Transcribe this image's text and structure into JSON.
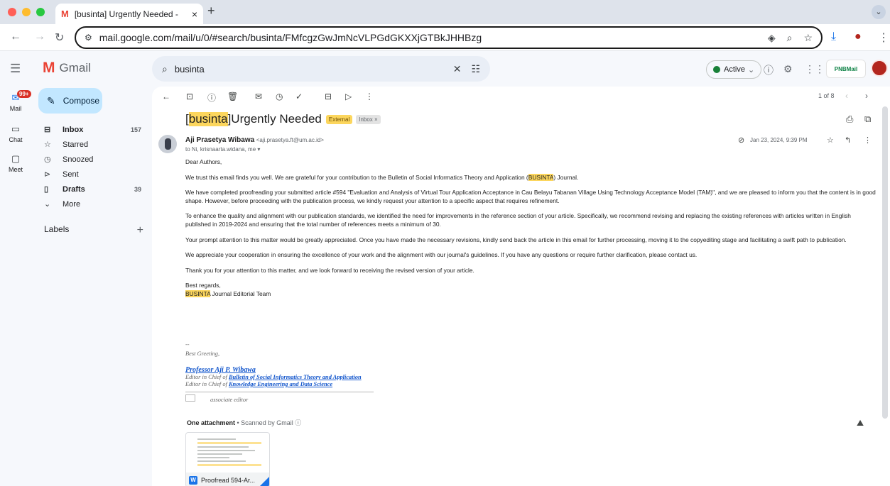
{
  "browser": {
    "tab_title": "[businta] Urgently Needed - ",
    "tab_close": "×",
    "new_tab": "+",
    "tab_menu": "⌄",
    "url": "mail.google.com/mail/u/0/#search/businta/FMfcgzGwJmNcVLPGdGKXXjGTBkJHHBzg"
  },
  "gmail": {
    "app_name": "Gmail",
    "search_value": "businta",
    "status": "Active",
    "status_color": "#188038",
    "org_logo": "PNBMail"
  },
  "rail": {
    "mail_label": "Mail",
    "mail_badge": "99+",
    "chat_label": "Chat",
    "meet_label": "Meet"
  },
  "compose_label": "Compose",
  "folders": [
    {
      "label": "Inbox",
      "count": "157",
      "icon": "inbox-icon",
      "bold": true
    },
    {
      "label": "Starred",
      "count": "",
      "icon": "star-icon",
      "bold": false
    },
    {
      "label": "Snoozed",
      "count": "",
      "icon": "clock-icon",
      "bold": false
    },
    {
      "label": "Sent",
      "count": "",
      "icon": "send-icon",
      "bold": false
    },
    {
      "label": "Drafts",
      "count": "39",
      "icon": "draft-icon",
      "bold": true
    },
    {
      "label": "More",
      "count": "",
      "icon": "chevron-down-icon",
      "bold": false
    }
  ],
  "labels_heading": "Labels",
  "pager": "1 of 8",
  "email": {
    "subject_tag": "businta",
    "subject_rest": " Urgently Needed",
    "external_chip": "External",
    "inbox_chip": "Inbox ×",
    "sender_name": "Aji Prasetya Wibawa",
    "sender_email": "<aji.prasetya.ft@um.ac.id>",
    "recipients": "to Ni, krisnaarta.widana, me ▾",
    "date": "Jan 23, 2024, 9:39 PM",
    "greeting": "Dear Authors,",
    "p1_a": "We trust this email finds you well. We are grateful for your contribution to the Bulletin of Social Informatics Theory and Application (",
    "p1_hl": "BUSINTA",
    "p1_b": ") Journal.",
    "p2": "We have completed proofreading your submitted article #594 \"Evaluation and Analysis of Virtual Tour Application Acceptance in Cau Belayu Tabanan Village Using Technology Acceptance Model (TAM)\", and we are pleased to inform you that the content is in good shape. However, before proceeding with the publication process, we kindly request your attention to a specific aspect that requires refinement.",
    "p3": "To enhance the quality and alignment with our publication standards, we identified the need for improvements in the reference section of your article. Specifically, we recommend revising and replacing the existing references with articles written in English published in 2019-2024 and ensuring that the total number of references meets a minimum of 30.",
    "p4": "Your prompt attention to this matter would be greatly appreciated. Once you have made the necessary revisions, kindly send back the article in this email for further processing, moving it to the copyediting stage and facilitating a swift path to publication.",
    "p5": "We appreciate your cooperation in ensuring the excellence of your work and the alignment with our journal's guidelines. If you have any questions or require further clarification, please contact us.",
    "p6": "Thank you for your attention to this matter, and we look forward to receiving the revised version of your article.",
    "closing": "Best regards,",
    "team_hl": "BUSINTA",
    "team_rest": " Journal Editorial Team",
    "sig_dash": "--",
    "sig_greeting": "Best Greeting,",
    "sig_name": "Professor Aji P. Wibawa",
    "sig_line1_prefix": "Editor in Chief of ",
    "sig_line1_link": "Bulletin of Social Informatics Theory and Application",
    "sig_line2_prefix": "Editor in Chief of  ",
    "sig_line2_link": "Knowledge Engineering and Data Science",
    "sig_assoc": "associate editor",
    "attachment_heading": "One attachment",
    "attachment_scanned": " • Scanned by Gmail ⓘ",
    "attachment_name": "Proofread 594-Ar...",
    "attachment_type": "W"
  }
}
